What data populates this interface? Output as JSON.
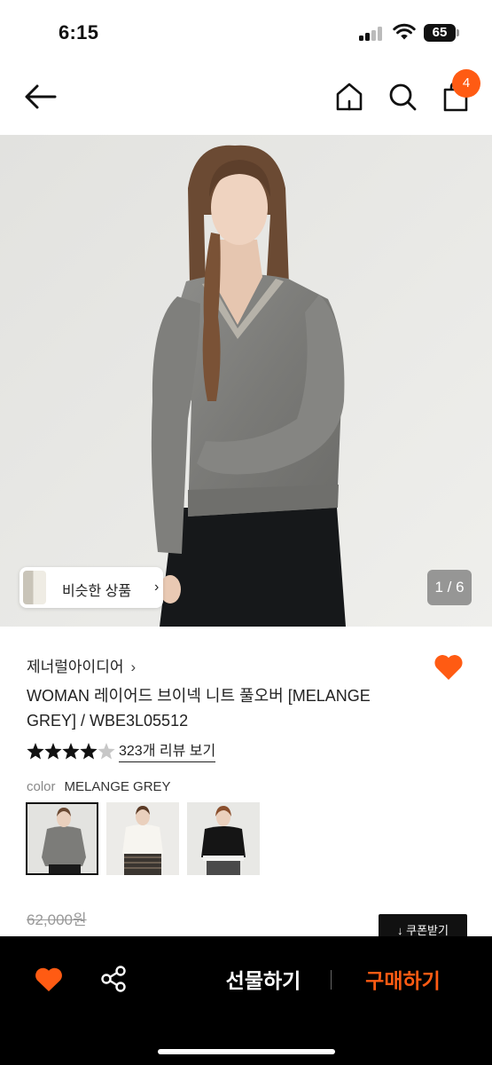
{
  "status_bar": {
    "time": "6:15",
    "battery": "65",
    "icons": [
      "cellular-signal-icon",
      "wifi-icon",
      "battery-icon"
    ]
  },
  "nav": {
    "icons": [
      "back-arrow-icon",
      "home-icon",
      "search-icon",
      "shopping-bag-icon"
    ],
    "cart_count": "4"
  },
  "gallery": {
    "similar_label": "비슷한 상품",
    "similar_chevron": "›",
    "page_indicator": "1 / 6"
  },
  "product": {
    "brand": "제너럴아이디어",
    "brand_chevron": "›",
    "title": "WOMAN 레이어드 브이넥 니트 풀오버 [MELANGE GREY] / WBE3L05512",
    "rating": 4.5,
    "review_link": "323개 리뷰 보기",
    "color_label": "color",
    "color_value": "MELANGE GREY",
    "swatches": [
      "melange-grey",
      "ivory",
      "black"
    ],
    "original_price": "62,000원",
    "coupon_label": "↓ 쿠폰받기",
    "wishlisted": true
  },
  "bottom_bar": {
    "gift_label": "선물하기",
    "buy_label": "구매하기",
    "icons": [
      "heart-icon",
      "share-icon"
    ]
  },
  "colors": {
    "accent": "#ff5b13",
    "bar_background": "#000000"
  }
}
